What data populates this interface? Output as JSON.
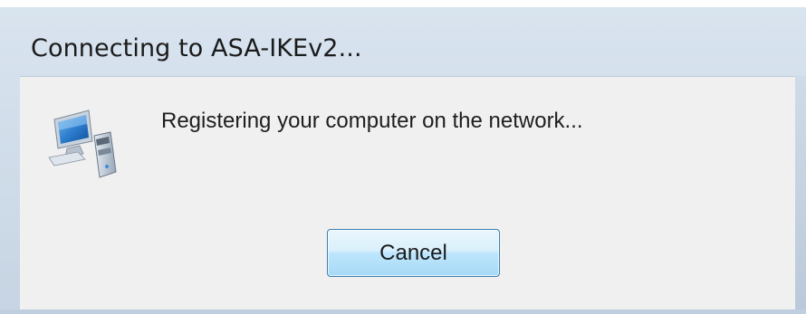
{
  "dialog": {
    "title": "Connecting to ASA-IKEv2...",
    "message": "Registering your computer on the network...",
    "icon": "network-computer-icon",
    "cancel_label": "Cancel"
  },
  "colors": {
    "frame": "#cedbe8",
    "content_bg": "#f0f0f0",
    "button_border": "#3c7fb1",
    "button_fill": "#bee6fd"
  }
}
